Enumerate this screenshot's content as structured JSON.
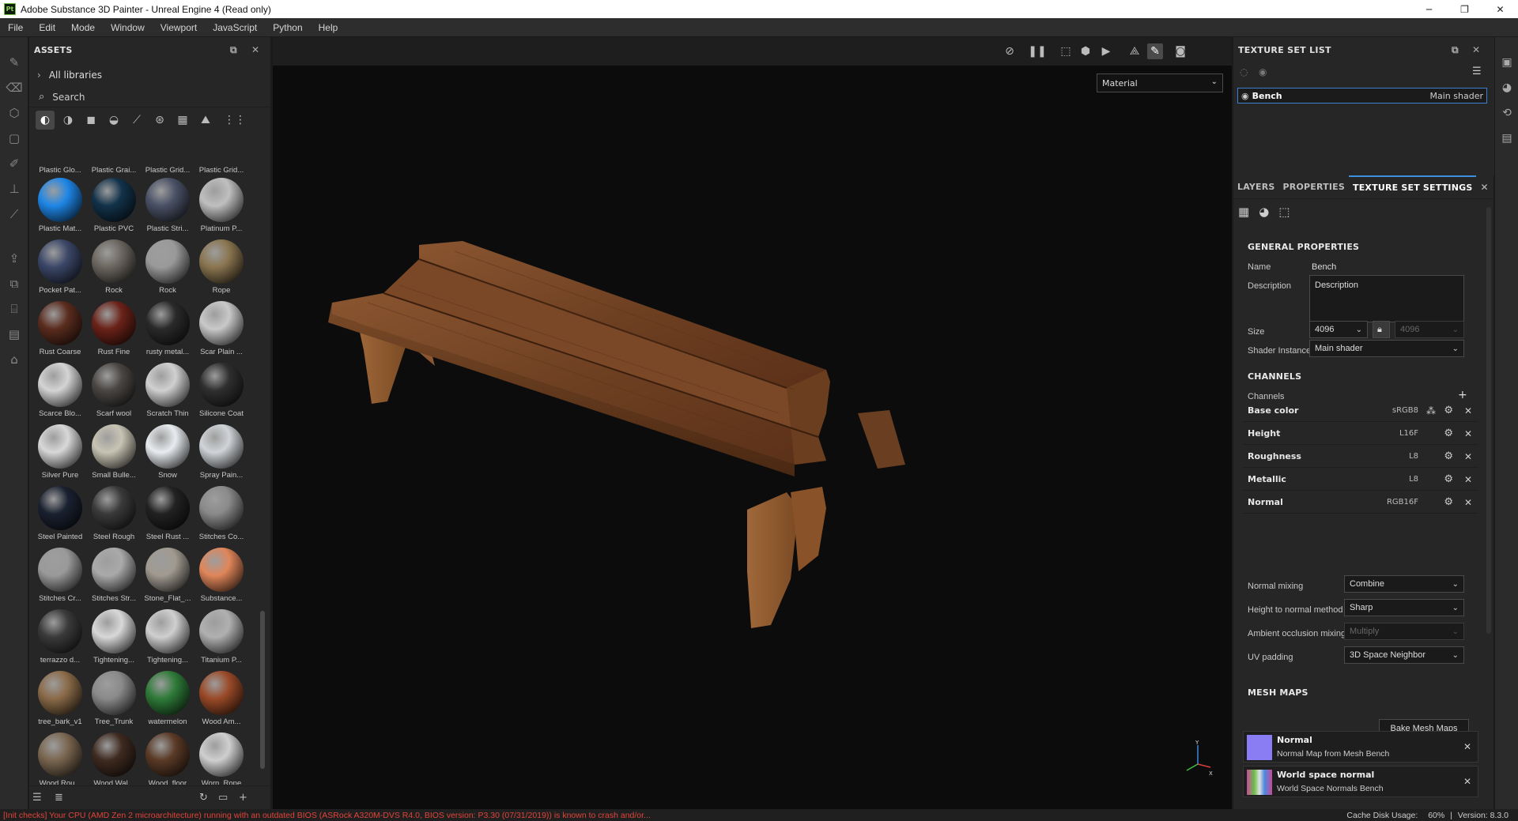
{
  "window": {
    "app_icon": "Pt",
    "title": "Adobe Substance 3D Painter - Unreal Engine 4 (Read only)",
    "controls": [
      "─",
      "❐",
      "✕"
    ]
  },
  "menu": [
    "File",
    "Edit",
    "Mode",
    "Window",
    "Viewport",
    "JavaScript",
    "Python",
    "Help"
  ],
  "assets": {
    "header": "ASSETS",
    "libraries": "All libraries",
    "search_placeholder": "Search",
    "items": [
      {
        "name": "Plastic Glo...",
        "color": "#1f6fd6",
        "partial": true
      },
      {
        "name": "Plastic Grai...",
        "color": "#2b2d33",
        "partial": true
      },
      {
        "name": "Plastic Grid...",
        "color": "#2e3444",
        "partial": true
      },
      {
        "name": "Plastic Grid...",
        "color": "#7a2a22",
        "partial": true
      },
      {
        "name": "Plastic Mat...",
        "color": "#1e86e6"
      },
      {
        "name": "Plastic PVC",
        "color": "#12324a"
      },
      {
        "name": "Plastic Stri...",
        "color": "#4a5166"
      },
      {
        "name": "Platinum P...",
        "color": "#bfbfbf"
      },
      {
        "name": "Pocket Pat...",
        "color": "#3b4768"
      },
      {
        "name": "Rock",
        "color": "#6b665f"
      },
      {
        "name": "Rock",
        "color": "#9a9a9a"
      },
      {
        "name": "Rope",
        "color": "#8a7550"
      },
      {
        "name": "Rust Coarse",
        "color": "#5a2c1e"
      },
      {
        "name": "Rust Fine",
        "color": "#6a2218"
      },
      {
        "name": "rusty metal...",
        "color": "#2a2a2a"
      },
      {
        "name": "Scar Plain ...",
        "color": "#c9c9c9"
      },
      {
        "name": "Scarce Blo...",
        "color": "#d4d4d4"
      },
      {
        "name": "Scarf wool",
        "color": "#4a4643"
      },
      {
        "name": "Scratch Thin",
        "color": "#d0d0d0"
      },
      {
        "name": "Silicone Coat",
        "color": "#2f2f2f"
      },
      {
        "name": "Silver Pure",
        "color": "#d8d8d8"
      },
      {
        "name": "Small Bulle...",
        "color": "#c8c4b4"
      },
      {
        "name": "Snow",
        "color": "#e8ecf0"
      },
      {
        "name": "Spray Pain...",
        "color": "#d0d4d8"
      },
      {
        "name": "Steel Painted",
        "color": "#1a2130"
      },
      {
        "name": "Steel Rough",
        "color": "#3a3a3a"
      },
      {
        "name": "Steel Rust ...",
        "color": "#222"
      },
      {
        "name": "Stitches Co...",
        "color": "#8a8a8a"
      },
      {
        "name": "Stitches Cr...",
        "color": "#9a9a9a"
      },
      {
        "name": "Stitches Str...",
        "color": "#aaaaaa"
      },
      {
        "name": "Stone_Flat_...",
        "color": "#a09a90"
      },
      {
        "name": "Substance...",
        "color": "#e0865a"
      },
      {
        "name": "terrazzo d...",
        "color": "#3a3a3a"
      },
      {
        "name": "Tightening...",
        "color": "#d8d8d8"
      },
      {
        "name": "Tightening...",
        "color": "#cfcfcf"
      },
      {
        "name": "Titanium P...",
        "color": "#b0b0b0"
      },
      {
        "name": "tree_bark_v1",
        "color": "#8a6a48"
      },
      {
        "name": "Tree_Trunk",
        "color": "#8a8a8a"
      },
      {
        "name": "watermelon",
        "color": "#2e7a38"
      },
      {
        "name": "Wood Am...",
        "color": "#9a4a28"
      },
      {
        "name": "Wood Rou...",
        "color": "#7a6650"
      },
      {
        "name": "Wood Wal...",
        "color": "#3e2a20"
      },
      {
        "name": "Wood_floor",
        "color": "#5a3a26"
      },
      {
        "name": "Worn_Rope",
        "color": "#cfcfcf"
      }
    ]
  },
  "viewport": {
    "display_select": "Material"
  },
  "texture_set_list": {
    "header": "TEXTURE SET LIST",
    "set_name": "Bench",
    "set_shader": "Main shader"
  },
  "right_tabs": [
    "LAYERS",
    "PROPERTIES",
    "TEXTURE SET SETTINGS"
  ],
  "tss": {
    "general_header": "GENERAL PROPERTIES",
    "name_label": "Name",
    "name_value": "Bench",
    "description_label": "Description",
    "description_value": "Description",
    "size_label": "Size",
    "size_value": "4096",
    "size_value2": "4096",
    "shader_label": "Shader Instance",
    "shader_value": "Main shader",
    "channels_header": "CHANNELS",
    "channels_label": "Channels",
    "channels": [
      {
        "name": "Base color",
        "format": "sRGB8"
      },
      {
        "name": "Height",
        "format": "L16F"
      },
      {
        "name": "Roughness",
        "format": "L8"
      },
      {
        "name": "Metallic",
        "format": "L8"
      },
      {
        "name": "Normal",
        "format": "RGB16F"
      }
    ],
    "normal_mixing_label": "Normal mixing",
    "normal_mixing_value": "Combine",
    "h2n_label": "Height to normal method",
    "h2n_value": "Sharp",
    "ao_label": "Ambient occlusion mixing",
    "ao_value": "Multiply",
    "uv_label": "UV padding",
    "uv_value": "3D Space Neighbor",
    "mesh_header": "MESH MAPS",
    "bake_button": "Bake Mesh Maps",
    "mesh_maps": [
      {
        "title": "Normal",
        "subtitle": "Normal Map from Mesh Bench",
        "color": "#8a7cf2"
      },
      {
        "title": "World space normal",
        "subtitle": "World Space Normals Bench",
        "color": "#6a9a5a"
      }
    ]
  },
  "status": {
    "error": "[Init checks] Your CPU (AMD Zen 2 microarchitecture) running with an outdated BIOS (ASRock A320M-DVS R4.0, BIOS version: P3.30 (07/31/2019)) is known to crash and/or...",
    "cache_label": "Cache Disk Usage:",
    "cache_value": "60%",
    "version": "Version: 8.3.0"
  }
}
